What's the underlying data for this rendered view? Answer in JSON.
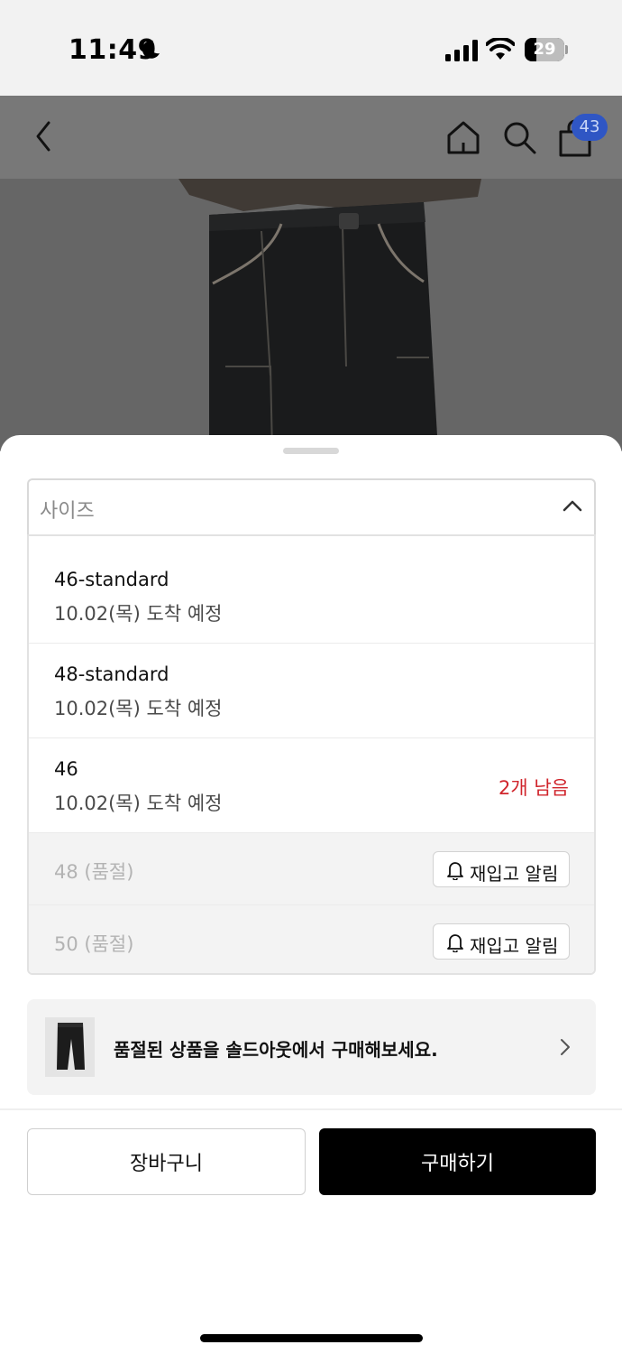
{
  "status_bar": {
    "time": "11:49",
    "battery": "29",
    "battery_level": 0.29,
    "icons": [
      "moon-icon",
      "signal-icon",
      "wifi-icon",
      "battery-icon"
    ]
  },
  "nav": {
    "icons": [
      "back-icon",
      "home-icon",
      "search-icon",
      "cart-icon"
    ],
    "cart_count": "43",
    "badge_color": "#2f56c4"
  },
  "sheet": {
    "dropdown_label": "사이즈",
    "options": [
      {
        "name": "46-standard",
        "arrival": "10.02(목) 도착 예정"
      },
      {
        "name": "48-standard",
        "arrival": "10.02(목) 도착 예정"
      },
      {
        "name": "46",
        "arrival": "10.02(목) 도착 예정",
        "stock": "2개 남음"
      }
    ],
    "soldout_options": [
      {
        "label": "48 (품절)",
        "restock": "재입고 알림"
      },
      {
        "label": "50 (품절)",
        "restock": "재입고 알림"
      }
    ],
    "soldout_banner": "품절된 상품을 솔드아웃에서 구매해보세요.",
    "cart_button": "장바구니",
    "buy_button": "구매하기",
    "stock_color": "#d0252c"
  }
}
